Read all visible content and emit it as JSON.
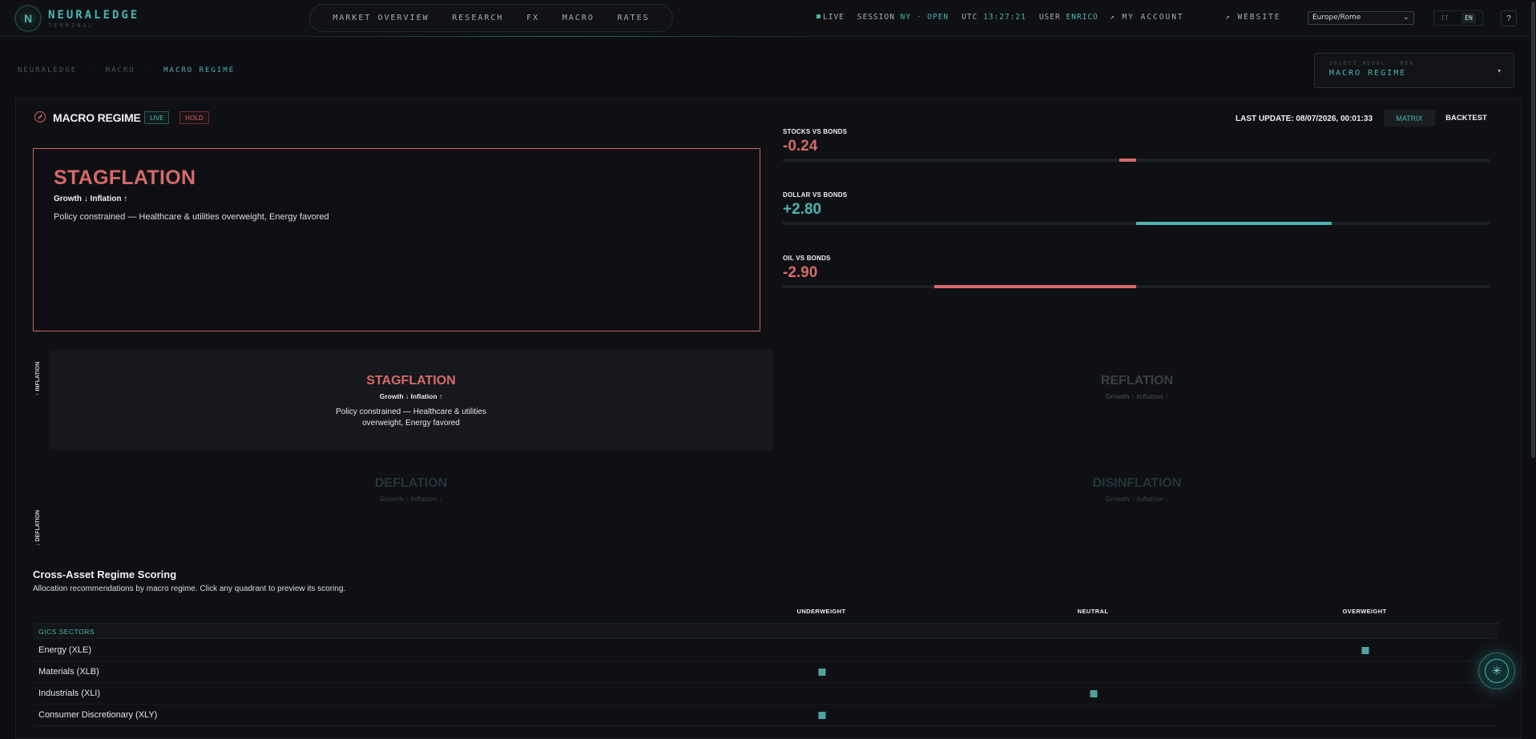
{
  "brand": {
    "name": "NEURALEDGE",
    "sub": "TERMINAL",
    "mark": "N"
  },
  "nav": [
    "MARKET OVERVIEW",
    "RESEARCH",
    "FX",
    "MACRO",
    "RATES"
  ],
  "status": {
    "live": "LIVE",
    "session_label": "SESSION",
    "session_value": "NY · OPEN",
    "utc_label": "UTC",
    "utc_value": "13:27:21",
    "user_label": "USER",
    "user_value": "ENRICO"
  },
  "account": "↗ MY ACCOUNT",
  "website": "↗ WEBSITE",
  "timezone": "Europe/Rome",
  "lang": {
    "it": "IT",
    "en": "EN"
  },
  "help": "?",
  "breadcrumb": {
    "root": "NEURALEDGE",
    "section": "MACRO",
    "current": "MACRO REGIME",
    "sep": "·"
  },
  "model_select": {
    "label": "SELECT MODEL · REG",
    "value": "MACRO REGIME"
  },
  "panel": {
    "title": "MACRO REGIME",
    "badge_live": "LIVE",
    "badge_hold": "HOLD",
    "last_update": "LAST UPDATE: 08/07/2026, 00:01:33",
    "btn_matrix": "MATRIX",
    "btn_backtest": "BACKTEST"
  },
  "hero": {
    "name": "STAGFLATION",
    "axes": "Growth ↓ Inflation ↑",
    "desc": "Policy constrained — Healthcare & utilities overweight, Energy favored"
  },
  "metrics": [
    {
      "label": "STOCKS VS BONDS",
      "value": "-0.24",
      "num": -0.24
    },
    {
      "label": "DOLLAR VS BONDS",
      "value": "+2.80",
      "num": 2.8
    },
    {
      "label": "OIL VS BONDS",
      "value": "-2.90",
      "num": -2.9
    }
  ],
  "colors": {
    "neg": "#d46a6a",
    "pos": "#4fb3ae"
  },
  "quadrants": {
    "stagflation": {
      "name": "STAGFLATION",
      "axes": "Growth ↓ Inflation ↑",
      "desc": "Policy constrained — Healthcare & utilities overweight, Energy favored"
    },
    "reflation": {
      "name": "REFLATION",
      "axes": "Growth ↑ Inflation ↑"
    },
    "deflation": {
      "name": "DEFLATION",
      "axes": "Growth ↓ Inflation ↓"
    },
    "disinflation": {
      "name": "DISINFLATION",
      "axes": "Growth ↑ Inflation ↓"
    }
  },
  "axis_labels": {
    "top": "↑ INFLATION",
    "bottom": "↓ DEFLATION"
  },
  "scoring": {
    "title": "Cross-Asset Regime Scoring",
    "subtitle": "Allocation recommendations by macro regime. Click any quadrant to preview its scoring.",
    "columns": [
      "UNDERWEIGHT",
      "NEUTRAL",
      "OVERWEIGHT"
    ],
    "group": "GICS SECTORS",
    "rows": [
      {
        "label": "Energy (XLE)",
        "score": "OVERWEIGHT"
      },
      {
        "label": "Materials (XLB)",
        "score": "UNDERWEIGHT"
      },
      {
        "label": "Industrials (XLI)",
        "score": "NEUTRAL"
      },
      {
        "label": "Consumer Discretionary (XLY)",
        "score": "UNDERWEIGHT"
      }
    ]
  },
  "fab_icon": "✳"
}
